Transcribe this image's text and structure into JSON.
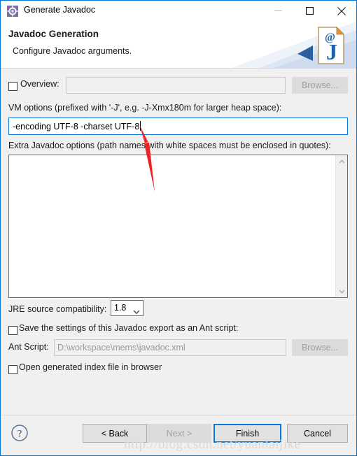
{
  "window": {
    "title": "Generate Javadoc",
    "icon": "javadoc-gear-icon",
    "minimize_label": "Minimize",
    "maximize_label": "Maximize",
    "close_label": "Close",
    "accent_color": "#0a7ad6"
  },
  "header": {
    "title": "Javadoc Generation",
    "subtitle": "Configure Javadoc arguments.",
    "banner_icon": "javadoc-page-icon"
  },
  "form": {
    "overview": {
      "checkbox_label": "Overview:",
      "checked": false,
      "value": "",
      "placeholder": "",
      "browse_label": "Browse...",
      "enabled": false
    },
    "vm_options": {
      "label": "VM options (prefixed with '-J', e.g. -J-Xmx180m for larger heap space):",
      "value": "-encoding UTF-8 -charset UTF-8",
      "focused": true
    },
    "extra_options": {
      "label": "Extra Javadoc options (path names with white spaces must be enclosed in quotes):",
      "value": ""
    },
    "jre_compatibility": {
      "label": "JRE source compatibility:",
      "selected": "1.8"
    },
    "ant_save": {
      "checkbox_label": "Save the settings of this Javadoc export as an Ant script:",
      "checked": false
    },
    "ant_script": {
      "label": "Ant Script:",
      "value": "D:\\workspace\\mems\\javadoc.xml",
      "browse_label": "Browse...",
      "enabled": false
    },
    "open_index": {
      "checkbox_label": "Open generated index file in browser",
      "checked": false
    }
  },
  "footer": {
    "help_label": "Help",
    "back_label": "< Back",
    "next_label": "Next >",
    "next_enabled": false,
    "finish_label": "Finish",
    "finish_default": true,
    "cancel_label": "Cancel"
  },
  "annotations": {
    "arrow_color": "#ee2222",
    "watermark": "http://blog.csdn.net/yuanlaijike"
  }
}
